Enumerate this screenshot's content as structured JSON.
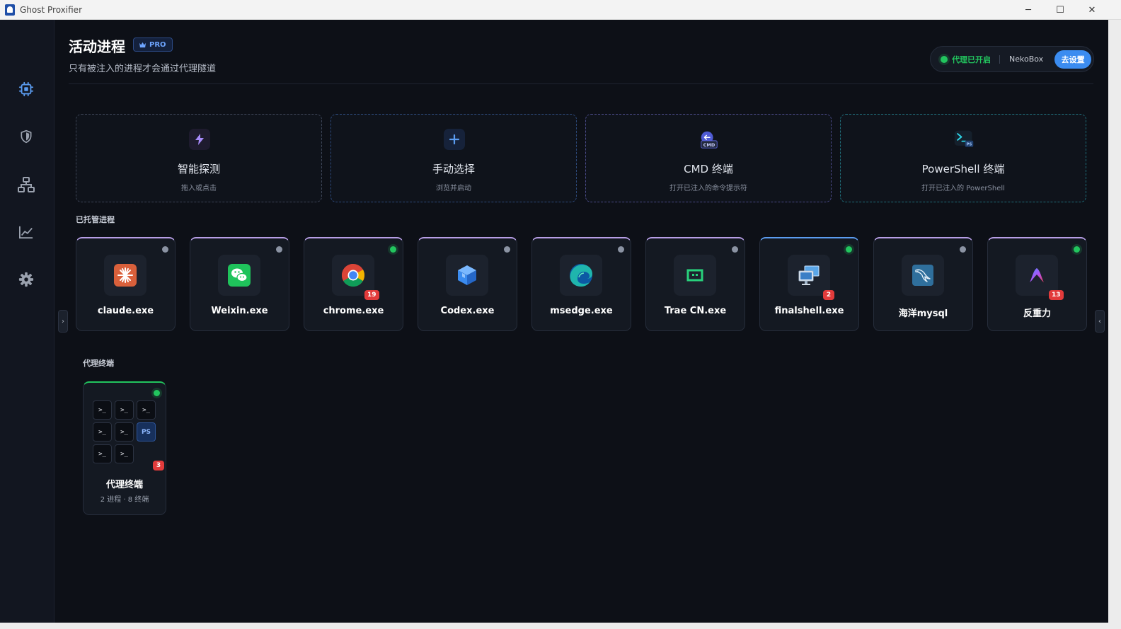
{
  "window": {
    "title": "Ghost Proxifier",
    "minimize_glyph": "─",
    "maximize_glyph": "☐",
    "close_glyph": "✕"
  },
  "sidebar": {
    "items": [
      {
        "icon": "cpu-chip-icon",
        "active": true
      },
      {
        "icon": "shield-icon",
        "active": false
      },
      {
        "icon": "network-topology-icon",
        "active": false
      },
      {
        "icon": "line-chart-icon",
        "active": false
      },
      {
        "icon": "gear-icon",
        "active": false
      }
    ]
  },
  "header": {
    "title": "活动进程",
    "badge": "PRO",
    "subtitle": "只有被注入的进程才会通过代理隧道"
  },
  "status": {
    "text": "代理已开启",
    "core": "NekoBox",
    "button": "去设置",
    "color": "#22c55e"
  },
  "actions": [
    {
      "title": "智能探测",
      "subtitle": "拖入或点击",
      "icon": "lightning-icon"
    },
    {
      "title": "手动选择",
      "subtitle": "浏览并启动",
      "icon": "plus-icon"
    },
    {
      "title": "CMD 终端",
      "subtitle": "打开已注入的命令提示符",
      "icon": "cmd-icon",
      "icon_tag": "CMD"
    },
    {
      "title": "PowerShell 终端",
      "subtitle": "打开已注入的 PowerShell",
      "icon": "powershell-icon",
      "icon_tag": "PS"
    }
  ],
  "managed": {
    "label": "已托管进程",
    "processes": [
      {
        "name": "claude.exe",
        "icon": "claude-icon",
        "active": false,
        "badge": ""
      },
      {
        "name": "Weixin.exe",
        "icon": "wechat-icon",
        "active": false,
        "badge": ""
      },
      {
        "name": "chrome.exe",
        "icon": "chrome-icon",
        "active": true,
        "badge": "19"
      },
      {
        "name": "Codex.exe",
        "icon": "codex-cube-icon",
        "active": false,
        "badge": ""
      },
      {
        "name": "msedge.exe",
        "icon": "edge-icon",
        "active": false,
        "badge": ""
      },
      {
        "name": "Trae CN.exe",
        "icon": "trae-icon",
        "active": false,
        "badge": ""
      },
      {
        "name": "finalshell.exe",
        "icon": "finalshell-icon",
        "active": true,
        "badge": "2"
      },
      {
        "name": "海洋mysql",
        "icon": "mysql-dolphin-icon",
        "active": false,
        "badge": ""
      },
      {
        "name": "反重力",
        "icon": "antigravity-icon",
        "active": true,
        "badge": "13"
      }
    ],
    "scroll_left": "›",
    "scroll_right": "‹"
  },
  "terminals": {
    "label": "代理终端",
    "card": {
      "name": "代理终端",
      "summary": "2 进程 · 8 终端",
      "badge": "3",
      "active": true,
      "cells": [
        ">_",
        ">_",
        ">_",
        ">_",
        ">_",
        "PS",
        ">_",
        ">_"
      ]
    }
  },
  "colors": {
    "accent": "#3b8cf0",
    "active": "#22c55e",
    "badge": "#e23b3b",
    "card_top": "#b79ee6"
  }
}
